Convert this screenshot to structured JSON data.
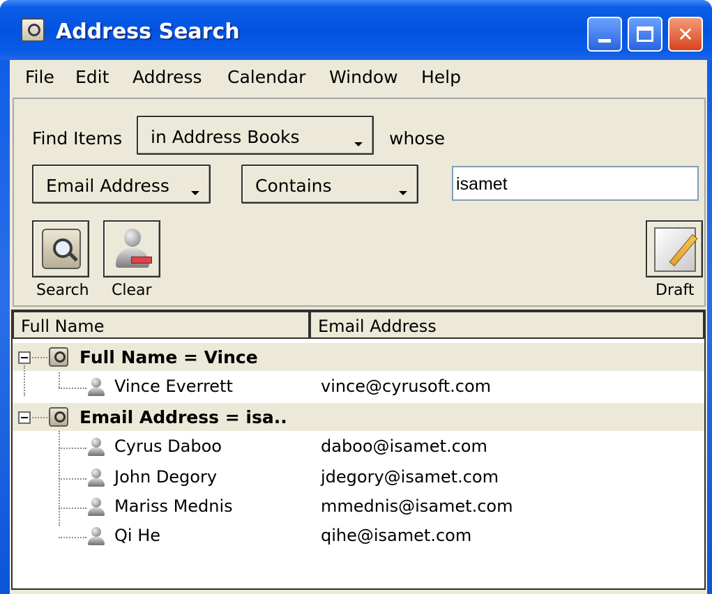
{
  "window": {
    "title": "Address Search"
  },
  "menu": [
    "File",
    "Edit",
    "Address",
    "Calendar",
    "Window",
    "Help"
  ],
  "search": {
    "find_label": "Find Items",
    "scope": "in Address Books",
    "whose_label": "whose",
    "field": "Email Address",
    "operator": "Contains",
    "value": "isamet",
    "buttons": {
      "search": "Search",
      "clear": "Clear",
      "draft": "Draft"
    }
  },
  "results": {
    "columns": [
      "Full Name",
      "Email Address"
    ],
    "groups": [
      {
        "label": "Full Name = Vince",
        "items": [
          {
            "name": "Vince Everrett",
            "email": "vince@cyrusoft.com"
          }
        ]
      },
      {
        "label": "Email Address = isa..",
        "items": [
          {
            "name": "Cyrus Daboo",
            "email": "daboo@isamet.com"
          },
          {
            "name": "John Degory",
            "email": "jdegory@isamet.com"
          },
          {
            "name": "Mariss Mednis",
            "email": "mmednis@isamet.com"
          },
          {
            "name": "Qi He",
            "email": "qihe@isamet.com"
          }
        ]
      }
    ]
  },
  "colors": {
    "titlebar": "#0353e0",
    "panel": "#ece9d8",
    "close": "#d8441c"
  },
  "icons": [
    "app-icon",
    "minimize-icon",
    "maximize-icon",
    "close-icon",
    "search-book-icon",
    "clear-person-icon",
    "draft-icon",
    "collapse-icon",
    "search-group-icon",
    "person-icon"
  ]
}
